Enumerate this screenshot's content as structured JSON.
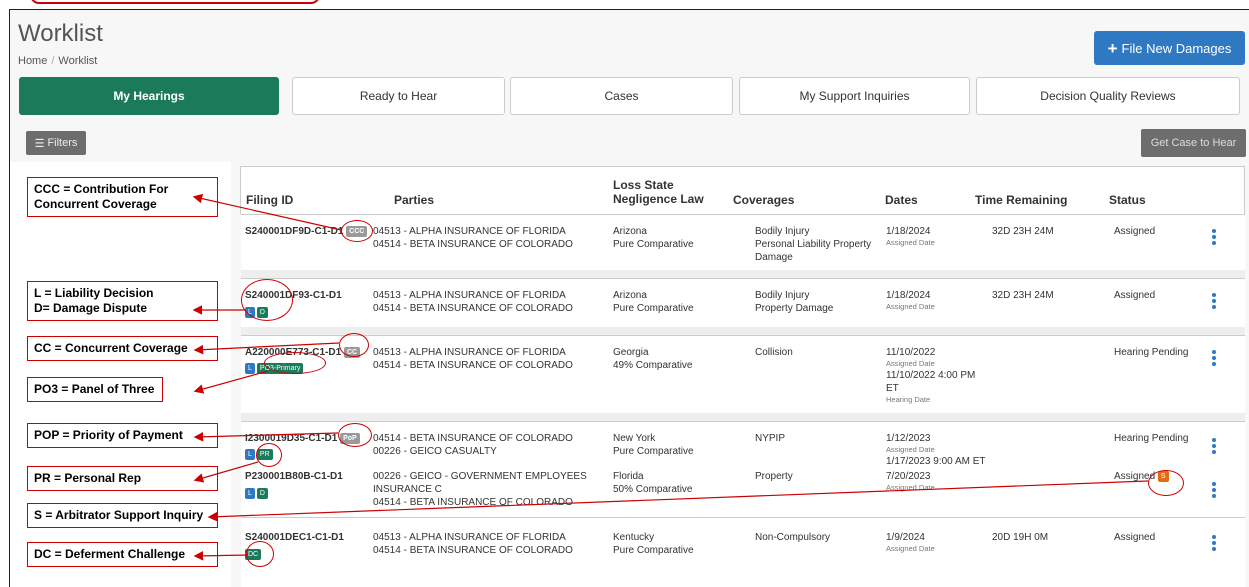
{
  "header": {
    "title": "Worklist",
    "breadcrumb": [
      "Home",
      "Worklist"
    ],
    "file_button": "File New Damages"
  },
  "tabs": [
    "My Hearings",
    "Ready to Hear",
    "Cases",
    "My Support Inquiries",
    "Decision Quality Reviews"
  ],
  "toolbar": {
    "filters_label": "Filters",
    "get_case_label": "Get Case to Hear"
  },
  "table": {
    "columns": {
      "filing_id": "Filing ID",
      "parties": "Parties",
      "loss_state_1": "Loss State",
      "loss_state_2": "Negligence Law",
      "coverages": "Coverages",
      "dates": "Dates",
      "time_remaining": "Time Remaining",
      "status": "Status"
    },
    "rows": [
      {
        "id": "S240001DF9D-C1-D1",
        "badges": [
          "CCC"
        ],
        "party1": "04513 - ALPHA INSURANCE OF FLORIDA",
        "party2": "04514 - BETA INSURANCE OF COLORADO",
        "state": "Arizona",
        "law": "Pure Comparative",
        "cov1": "Bodily Injury",
        "cov2": "Personal Liability Property",
        "cov3": "Damage",
        "date": "1/18/2024",
        "date_label": "Assigned Date",
        "time": "32D 23H 24M",
        "status": "Assigned"
      },
      {
        "id": "S240001DF93-C1-D1",
        "badges": [
          "L",
          "D"
        ],
        "party1": "04513 - ALPHA INSURANCE OF FLORIDA",
        "party2": "04514 - BETA INSURANCE OF COLORADO",
        "state": "Arizona",
        "law": "Pure Comparative",
        "cov1": "Bodily Injury",
        "cov2": "Property Damage",
        "date": "1/18/2024",
        "date_label": "Assigned Date",
        "time": "32D 23H 24M",
        "status": "Assigned"
      },
      {
        "id": "A220000E773-C1-D1",
        "badges": [
          "CC",
          "L",
          "PO3-Primary"
        ],
        "party1": "04513 - ALPHA INSURANCE OF FLORIDA",
        "party2": "04514 - BETA INSURANCE OF COLORADO",
        "state": "Georgia",
        "law": "49% Comparative",
        "cov1": "Collision",
        "date": "11/10/2022",
        "date_label": "Assigned Date",
        "date2": "11/10/2022 4:00 PM",
        "date2b": "ET",
        "date2_label": "Hearing Date",
        "status": "Hearing Pending"
      },
      {
        "id": "I2300019D35-C1-D1",
        "badges": [
          "PoP",
          "L",
          "PR"
        ],
        "party1": "04514 - BETA INSURANCE OF COLORADO",
        "party2": "00226 - GEICO CASUALTY",
        "state": "New York",
        "law": "Pure Comparative",
        "cov1": "NYPIP",
        "date": "1/12/2023",
        "date_label": "Assigned Date",
        "date2": "1/17/2023 9:00 AM ET",
        "status": "Hearing Pending"
      },
      {
        "id": "P230001B80B-C1-D1",
        "badges": [
          "L",
          "D",
          "S"
        ],
        "party1": "00226 - GEICO - GOVERNMENT EMPLOYEES",
        "party1b": "INSURANCE C",
        "party2": "04514 - BETA INSURANCE OF COLORADO",
        "state": "Florida",
        "law": "50% Comparative",
        "cov1": "Property",
        "date": "7/20/2023",
        "date_label": "Assigned Date",
        "status": "Assigned"
      },
      {
        "id": "S240001DEC1-C1-D1",
        "badges": [
          "DC"
        ],
        "party1": "04513 - ALPHA INSURANCE OF FLORIDA",
        "party2": "04514 - BETA INSURANCE OF COLORADO",
        "state": "Kentucky",
        "law": "Pure Comparative",
        "cov1": "Non-Compulsory",
        "date": "1/9/2024",
        "date_label": "Assigned Date",
        "time": "20D 19H 0M",
        "status": "Assigned"
      }
    ]
  },
  "legend": {
    "ccc": [
      "CCC = Contribution For",
      "Concurrent Coverage"
    ],
    "ld": [
      "L = Liability Decision",
      "D= Damage Dispute"
    ],
    "cc": "CC = Concurrent Coverage",
    "po3": "PO3 = Panel of Three",
    "pop": "POP = Priority of Payment",
    "pr": "PR = Personal Rep",
    "s": "S = Arbitrator Support Inquiry",
    "dc": "DC = Deferment Challenge"
  },
  "colors": {
    "accent": "#2f79c2",
    "active_tab": "#1a7a5a",
    "annotation": "#cc0000",
    "support_badge": "#e06d16"
  },
  "icons": [
    "plus-icon",
    "list-icon",
    "kebab-menu-icon"
  ]
}
